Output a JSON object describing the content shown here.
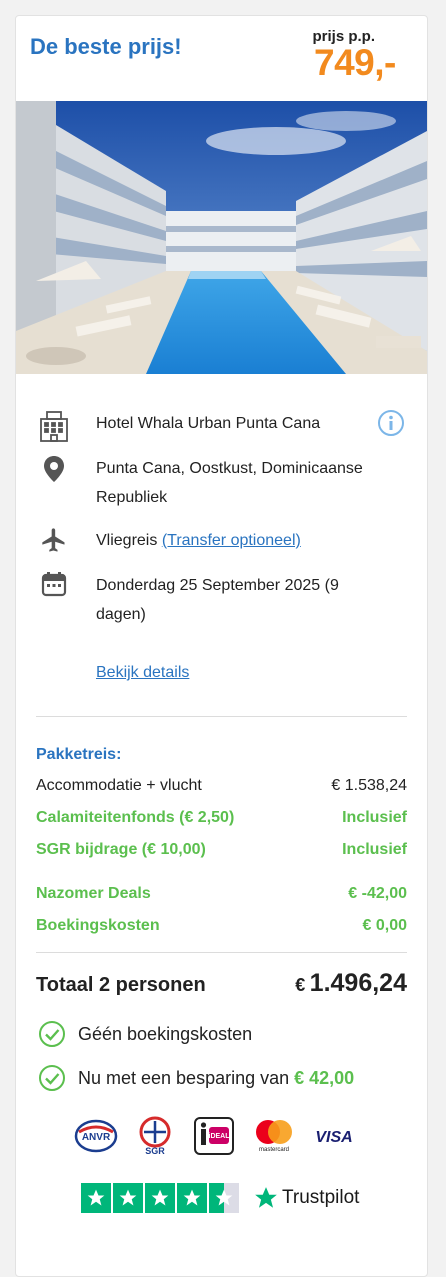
{
  "header": {
    "title": "De beste prijs!",
    "price_label": "prijs p.p.",
    "price": "749,-"
  },
  "hotel": {
    "name": "Hotel Whala Urban Punta Cana",
    "location": "Punta Cana, Oostkust, Dominicaanse Republiek",
    "travel_type": "Vliegreis",
    "transfer_link": "(Transfer optioneel)",
    "date": "Donderdag 25 September 2025 (9 dagen)",
    "details_link": "Bekijk details"
  },
  "package": {
    "heading": "Pakketreis:",
    "lines": [
      {
        "label": "Accommodatie + vlucht",
        "value": "€ 1.538,24"
      },
      {
        "label": "Calamiteitenfonds (€ 2,50)",
        "value": "Inclusief"
      },
      {
        "label": "SGR bijdrage (€ 10,00)",
        "value": "Inclusief"
      },
      {
        "label": "Nazomer Deals",
        "value": "€ -42,00"
      },
      {
        "label": "Boekingskosten",
        "value": "€ 0,00"
      }
    ]
  },
  "total": {
    "label": "Totaal 2 personen",
    "currency": "€",
    "amount": "1.496,24"
  },
  "benefits": {
    "no_fees": "Géén boekingskosten",
    "savings_prefix": "Nu met een besparing van",
    "savings_amount": "€ 42,00"
  },
  "payment_logos": {
    "anvr": "ANVR",
    "sgr": "SGR",
    "ideal": "iDEAL",
    "mastercard": "mastercard",
    "visa": "VISA"
  },
  "trustpilot": {
    "label": "Trustpilot",
    "stars": 4.5
  },
  "colors": {
    "brand_blue": "#2a74c0",
    "price_orange": "#f28a1e",
    "green": "#5bbf4e",
    "trustpilot_green": "#00b67a"
  }
}
